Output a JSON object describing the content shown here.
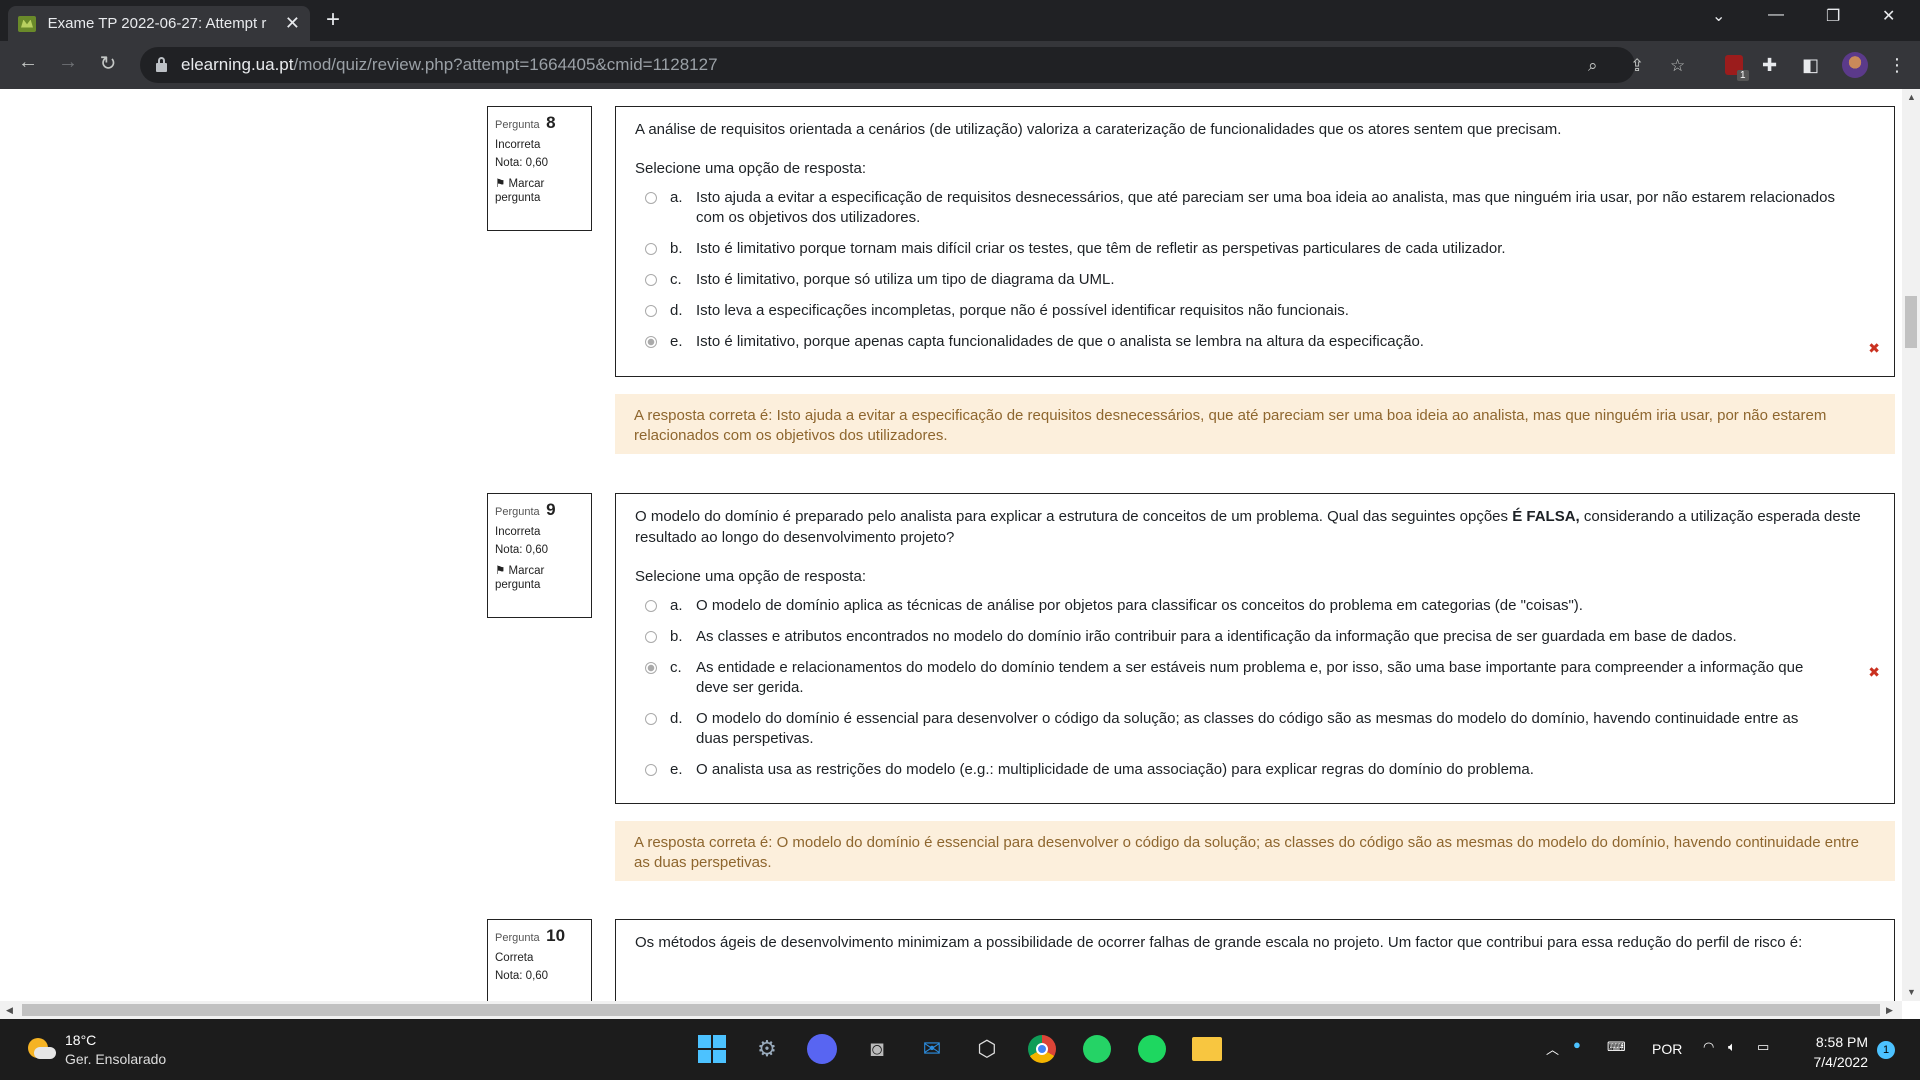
{
  "browser": {
    "tab_title": "Exame TP 2022-06-27: Attempt r",
    "url_host": "elearning.ua.pt",
    "url_path": "/mod/quiz/review.php?attempt=1664405&cmid=1128127",
    "ext_badge": "1"
  },
  "questions": [
    {
      "label": "Pergunta",
      "number": "8",
      "status": "Incorreta",
      "grade": "Nota: 0,60",
      "flag": "Marcar pergunta",
      "text": "A análise de requisitos orientada a cenários (de utilização) valoriza a caraterização de funcionalidades que os atores sentem que precisam.",
      "prompt": "Selecione uma opção de resposta:",
      "options": [
        {
          "letter": "a.",
          "text": "Isto ajuda a evitar a especificação de requisitos desnecessários, que até pareciam ser uma boa ideia ao analista, mas que ninguém iria usar, por não estarem relacionados com os objetivos dos utilizadores."
        },
        {
          "letter": "b.",
          "text": "Isto é limitativo porque tornam mais difícil criar os testes, que têm de refletir as perspetivas particulares de cada utilizador."
        },
        {
          "letter": "c.",
          "text": "Isto é limitativo, porque só utiliza um tipo de diagrama da UML."
        },
        {
          "letter": "d.",
          "text": "Isto leva a especificações incompletas, porque não é possível identificar requisitos não funcionais."
        },
        {
          "letter": "e.",
          "text": "Isto é limitativo, porque apenas capta funcionalidades de que o analista se lembra na altura da especificação."
        }
      ],
      "correct": "A resposta correta é: Isto ajuda a evitar a especificação de requisitos desnecessários, que até pareciam ser uma boa ideia ao analista, mas que ninguém iria usar, por não estarem relacionados com os objetivos dos utilizadores."
    },
    {
      "label": "Pergunta",
      "number": "9",
      "status": "Incorreta",
      "grade": "Nota: 0,60",
      "flag": "Marcar pergunta",
      "text_before": "O modelo do domínio é preparado pelo analista para explicar a estrutura de conceitos de um problema. Qual das seguintes opções ",
      "text_bold": "É FALSA,",
      "text_after": " considerando a utilização esperada deste resultado ao longo do desenvolvimento projeto?",
      "prompt": "Selecione uma opção de resposta:",
      "options": [
        {
          "letter": "a.",
          "text": "O modelo de domínio aplica as técnicas de análise por objetos para classificar os conceitos do problema em categorias (de \"coisas\")."
        },
        {
          "letter": "b.",
          "text": "As classes e  atributos encontrados no modelo do domínio irão contribuir para a identificação da informação que precisa de ser guardada em base de dados."
        },
        {
          "letter": "c.",
          "text": "As entidade e relacionamentos do modelo do domínio tendem a ser estáveis num problema e, por isso, são uma base importante para compreender a informação que deve ser gerida."
        },
        {
          "letter": "d.",
          "text": "O modelo do domínio é essencial para desenvolver o código da solução; as classes do código são as mesmas do modelo do domínio, havendo continuidade entre as duas perspetivas."
        },
        {
          "letter": "e.",
          "text": "O analista usa as restrições do modelo (e.g.: multiplicidade de uma associação) para explicar regras do domínio do problema."
        }
      ],
      "correct": "A resposta correta é: O modelo do domínio é essencial para desenvolver o código da solução; as classes do código são as mesmas do modelo do domínio, havendo continuidade entre as duas perspetivas."
    },
    {
      "label": "Pergunta",
      "number": "10",
      "status": "Correta",
      "grade": "Nota: 0,60",
      "text": "Os métodos ágeis de desenvolvimento minimizam a possibilidade de ocorrer falhas de grande escala no projeto. Um factor que contribui para essa redução do perfil de risco é:"
    }
  ],
  "taskbar": {
    "temp": "18°C",
    "weather": "Ger. Ensolarado",
    "lang": "POR",
    "time": "8:58 PM",
    "date": "7/4/2022",
    "notifications": "1"
  }
}
